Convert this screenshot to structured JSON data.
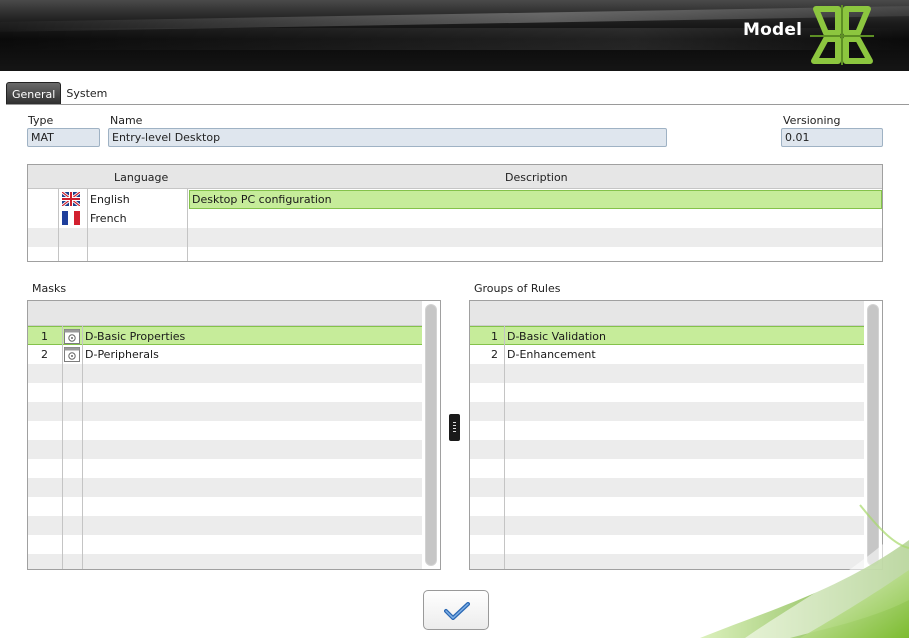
{
  "header": {
    "title": "Model"
  },
  "tabs": [
    {
      "label": "General",
      "active": true
    },
    {
      "label": "System",
      "active": false
    }
  ],
  "fields": {
    "type": {
      "label": "Type",
      "value": "MAT"
    },
    "name": {
      "label": "Name",
      "value": "Entry-level Desktop"
    },
    "versioning": {
      "label": "Versioning",
      "value": "0.01"
    }
  },
  "language_table": {
    "columns": [
      "Language",
      "Description"
    ],
    "rows": [
      {
        "flag": "uk-flag-icon",
        "language": "English",
        "description": "Desktop PC configuration",
        "selected": true
      },
      {
        "flag": "france-flag-icon",
        "language": "French",
        "description": "",
        "selected": false
      }
    ]
  },
  "masks": {
    "label": "Masks",
    "rows": [
      {
        "num": "1",
        "icon": "mask-icon",
        "name": "D-Basic Properties",
        "selected": true
      },
      {
        "num": "2",
        "icon": "mask-icon",
        "name": "D-Peripherals",
        "selected": false
      }
    ]
  },
  "groups_of_rules": {
    "label": "Groups of Rules",
    "rows": [
      {
        "num": "1",
        "name": "D-Basic Validation",
        "selected": true
      },
      {
        "num": "2",
        "name": "D-Enhancement",
        "selected": false
      }
    ]
  },
  "ok_button": {
    "icon": "checkmark-icon"
  },
  "colors": {
    "selection_fill": "#c6ec9a",
    "selection_border": "#84c24a",
    "brand_green": "#7fb83a",
    "header_dark": "#0a0a0a"
  }
}
